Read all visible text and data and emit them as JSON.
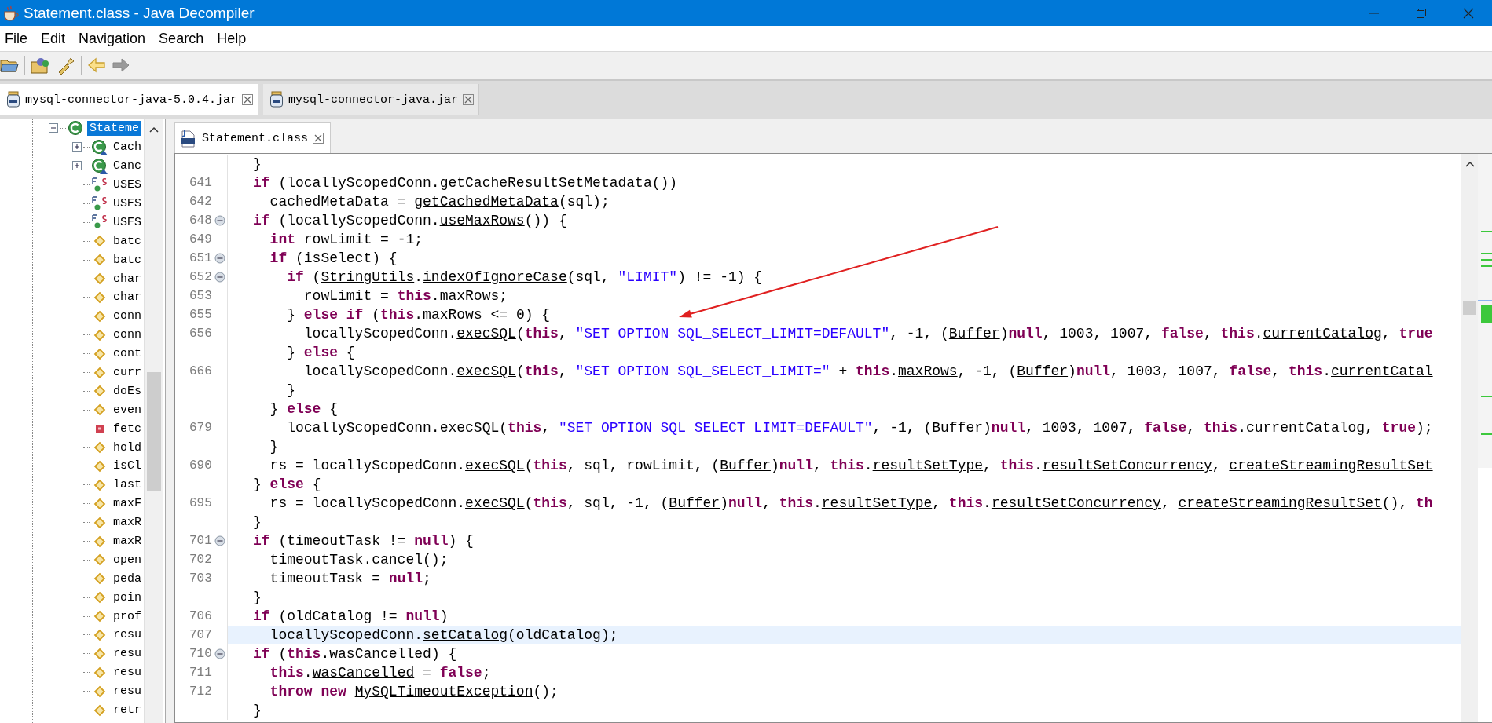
{
  "window": {
    "title": "Statement.class - Java Decompiler"
  },
  "menu": [
    "File",
    "Edit",
    "Navigation",
    "Search",
    "Help"
  ],
  "tabs": [
    {
      "label": "mysql-connector-java-5.0.4.jar",
      "selected": true
    },
    {
      "label": "mysql-connector-java.jar",
      "selected": false
    }
  ],
  "tree": {
    "items": [
      {
        "label": "Stateme",
        "kind": "class",
        "selected": true,
        "expanded": true,
        "children": [
          {
            "label": "Cach",
            "kind": "inner-class",
            "selected": false,
            "expanded": false
          },
          {
            "label": "Canc",
            "kind": "inner-class",
            "selected": false,
            "expanded": false
          },
          {
            "label": "USES",
            "kind": "static-field",
            "selected": false
          },
          {
            "label": "USES",
            "kind": "static-field",
            "selected": false
          },
          {
            "label": "USES",
            "kind": "static-field",
            "selected": false
          },
          {
            "label": "batc",
            "kind": "method",
            "selected": false
          },
          {
            "label": "batc",
            "kind": "method",
            "selected": false
          },
          {
            "label": "char",
            "kind": "method",
            "selected": false
          },
          {
            "label": "char",
            "kind": "method",
            "selected": false
          },
          {
            "label": "conn",
            "kind": "method",
            "selected": false
          },
          {
            "label": "conn",
            "kind": "method",
            "selected": false
          },
          {
            "label": "cont",
            "kind": "method",
            "selected": false
          },
          {
            "label": "curr",
            "kind": "method",
            "selected": false
          },
          {
            "label": "doEs",
            "kind": "method",
            "selected": false
          },
          {
            "label": "even",
            "kind": "method",
            "selected": false
          },
          {
            "label": "fetc",
            "kind": "private-method",
            "selected": false
          },
          {
            "label": "hold",
            "kind": "method",
            "selected": false
          },
          {
            "label": "isCl",
            "kind": "method",
            "selected": false
          },
          {
            "label": "last",
            "kind": "method",
            "selected": false
          },
          {
            "label": "maxF",
            "kind": "method",
            "selected": false
          },
          {
            "label": "maxR",
            "kind": "method",
            "selected": false
          },
          {
            "label": "maxR",
            "kind": "method",
            "selected": false
          },
          {
            "label": "open",
            "kind": "method",
            "selected": false
          },
          {
            "label": "peda",
            "kind": "method",
            "selected": false
          },
          {
            "label": "poin",
            "kind": "method",
            "selected": false
          },
          {
            "label": "prof",
            "kind": "method",
            "selected": false
          },
          {
            "label": "resu",
            "kind": "method",
            "selected": false
          },
          {
            "label": "resu",
            "kind": "method",
            "selected": false
          },
          {
            "label": "resu",
            "kind": "method",
            "selected": false
          },
          {
            "label": "resu",
            "kind": "method",
            "selected": false
          },
          {
            "label": "retr",
            "kind": "method",
            "selected": false
          }
        ]
      }
    ]
  },
  "editor": {
    "tabs": [
      {
        "label": "Statement.class",
        "selected": true
      }
    ],
    "lines": [
      {
        "foldable": false,
        "highlighted": false,
        "tokens": [
          {
            "kind": "txt",
            "text": "  }"
          }
        ]
      },
      {
        "number": "641",
        "foldable": false,
        "highlighted": false,
        "tokens": [
          {
            "kind": "kw",
            "text": "  if"
          },
          {
            "kind": "txt",
            "text": " (locallyScopedConn."
          },
          {
            "kind": "ref",
            "text": "getCacheResultSetMetadata"
          },
          {
            "kind": "txt",
            "text": "())"
          }
        ]
      },
      {
        "number": "642",
        "foldable": false,
        "highlighted": false,
        "tokens": [
          {
            "kind": "txt",
            "text": "    cachedMetaData = "
          },
          {
            "kind": "ref",
            "text": "getCachedMetaData"
          },
          {
            "kind": "txt",
            "text": "(sql);"
          }
        ]
      },
      {
        "number": "648",
        "foldable": true,
        "highlighted": false,
        "tokens": [
          {
            "kind": "kw",
            "text": "  if"
          },
          {
            "kind": "txt",
            "text": " (locallyScopedConn."
          },
          {
            "kind": "ref",
            "text": "useMaxRows"
          },
          {
            "kind": "txt",
            "text": "()) {"
          }
        ]
      },
      {
        "number": "649",
        "foldable": false,
        "highlighted": false,
        "tokens": [
          {
            "kind": "kw",
            "text": "    int"
          },
          {
            "kind": "txt",
            "text": " rowLimit = -1;"
          }
        ]
      },
      {
        "number": "651",
        "foldable": true,
        "highlighted": false,
        "tokens": [
          {
            "kind": "kw",
            "text": "    if"
          },
          {
            "kind": "txt",
            "text": " (isSelect) {"
          }
        ]
      },
      {
        "number": "652",
        "foldable": true,
        "highlighted": false,
        "tokens": [
          {
            "kind": "kw",
            "text": "      if"
          },
          {
            "kind": "txt",
            "text": " ("
          },
          {
            "kind": "ref",
            "text": "StringUtils"
          },
          {
            "kind": "txt",
            "text": "."
          },
          {
            "kind": "ref",
            "text": "indexOfIgnoreCase"
          },
          {
            "kind": "txt",
            "text": "(sql, "
          },
          {
            "kind": "str",
            "text": "\"LIMIT\""
          },
          {
            "kind": "txt",
            "text": ") != -1) {"
          }
        ]
      },
      {
        "number": "653",
        "foldable": false,
        "highlighted": false,
        "tokens": [
          {
            "kind": "txt",
            "text": "        rowLimit = "
          },
          {
            "kind": "kw",
            "text": "this"
          },
          {
            "kind": "txt",
            "text": "."
          },
          {
            "kind": "ref",
            "text": "maxRows"
          },
          {
            "kind": "txt",
            "text": ";"
          }
        ]
      },
      {
        "number": "655",
        "foldable": false,
        "highlighted": false,
        "tokens": [
          {
            "kind": "txt",
            "text": "      } "
          },
          {
            "kind": "kw",
            "text": "else if"
          },
          {
            "kind": "txt",
            "text": " ("
          },
          {
            "kind": "kw",
            "text": "this"
          },
          {
            "kind": "txt",
            "text": "."
          },
          {
            "kind": "ref",
            "text": "maxRows"
          },
          {
            "kind": "txt",
            "text": " <= 0) {"
          }
        ]
      },
      {
        "number": "656",
        "foldable": false,
        "highlighted": false,
        "tokens": [
          {
            "kind": "txt",
            "text": "        locallyScopedConn."
          },
          {
            "kind": "ref",
            "text": "execSQL"
          },
          {
            "kind": "txt",
            "text": "("
          },
          {
            "kind": "kw",
            "text": "this"
          },
          {
            "kind": "txt",
            "text": ", "
          },
          {
            "kind": "str",
            "text": "\"SET OPTION SQL_SELECT_LIMIT=DEFAULT\""
          },
          {
            "kind": "txt",
            "text": ", -1, ("
          },
          {
            "kind": "ref",
            "text": "Buffer"
          },
          {
            "kind": "txt",
            "text": ")"
          },
          {
            "kind": "kw",
            "text": "null"
          },
          {
            "kind": "txt",
            "text": ", 1003, 1007, "
          },
          {
            "kind": "kw",
            "text": "false"
          },
          {
            "kind": "txt",
            "text": ", "
          },
          {
            "kind": "kw",
            "text": "this"
          },
          {
            "kind": "txt",
            "text": "."
          },
          {
            "kind": "ref",
            "text": "currentCatalog"
          },
          {
            "kind": "txt",
            "text": ", "
          },
          {
            "kind": "kw",
            "text": "true"
          }
        ]
      },
      {
        "foldable": false,
        "highlighted": false,
        "tokens": [
          {
            "kind": "txt",
            "text": "      } "
          },
          {
            "kind": "kw",
            "text": "else"
          },
          {
            "kind": "txt",
            "text": " {"
          }
        ]
      },
      {
        "number": "666",
        "foldable": false,
        "highlighted": false,
        "tokens": [
          {
            "kind": "txt",
            "text": "        locallyScopedConn."
          },
          {
            "kind": "ref",
            "text": "execSQL"
          },
          {
            "kind": "txt",
            "text": "("
          },
          {
            "kind": "kw",
            "text": "this"
          },
          {
            "kind": "txt",
            "text": ", "
          },
          {
            "kind": "str",
            "text": "\"SET OPTION SQL_SELECT_LIMIT=\""
          },
          {
            "kind": "txt",
            "text": " + "
          },
          {
            "kind": "kw",
            "text": "this"
          },
          {
            "kind": "txt",
            "text": "."
          },
          {
            "kind": "ref",
            "text": "maxRows"
          },
          {
            "kind": "txt",
            "text": ", -1, ("
          },
          {
            "kind": "ref",
            "text": "Buffer"
          },
          {
            "kind": "txt",
            "text": ")"
          },
          {
            "kind": "kw",
            "text": "null"
          },
          {
            "kind": "txt",
            "text": ", 1003, 1007, "
          },
          {
            "kind": "kw",
            "text": "false"
          },
          {
            "kind": "txt",
            "text": ", "
          },
          {
            "kind": "kw",
            "text": "this"
          },
          {
            "kind": "txt",
            "text": "."
          },
          {
            "kind": "ref",
            "text": "currentCatal"
          }
        ]
      },
      {
        "foldable": false,
        "highlighted": false,
        "tokens": [
          {
            "kind": "txt",
            "text": "      }"
          }
        ]
      },
      {
        "foldable": false,
        "highlighted": false,
        "tokens": [
          {
            "kind": "txt",
            "text": "    } "
          },
          {
            "kind": "kw",
            "text": "else"
          },
          {
            "kind": "txt",
            "text": " {"
          }
        ]
      },
      {
        "number": "679",
        "foldable": false,
        "highlighted": false,
        "tokens": [
          {
            "kind": "txt",
            "text": "      locallyScopedConn."
          },
          {
            "kind": "ref",
            "text": "execSQL"
          },
          {
            "kind": "txt",
            "text": "("
          },
          {
            "kind": "kw",
            "text": "this"
          },
          {
            "kind": "txt",
            "text": ", "
          },
          {
            "kind": "str",
            "text": "\"SET OPTION SQL_SELECT_LIMIT=DEFAULT\""
          },
          {
            "kind": "txt",
            "text": ", -1, ("
          },
          {
            "kind": "ref",
            "text": "Buffer"
          },
          {
            "kind": "txt",
            "text": ")"
          },
          {
            "kind": "kw",
            "text": "null"
          },
          {
            "kind": "txt",
            "text": ", 1003, 1007, "
          },
          {
            "kind": "kw",
            "text": "false"
          },
          {
            "kind": "txt",
            "text": ", "
          },
          {
            "kind": "kw",
            "text": "this"
          },
          {
            "kind": "txt",
            "text": "."
          },
          {
            "kind": "ref",
            "text": "currentCatalog"
          },
          {
            "kind": "txt",
            "text": ", "
          },
          {
            "kind": "kw",
            "text": "true"
          },
          {
            "kind": "txt",
            "text": ");"
          }
        ]
      },
      {
        "foldable": false,
        "highlighted": false,
        "tokens": [
          {
            "kind": "txt",
            "text": "    }"
          }
        ]
      },
      {
        "number": "690",
        "foldable": false,
        "highlighted": false,
        "tokens": [
          {
            "kind": "txt",
            "text": "    rs = locallyScopedConn."
          },
          {
            "kind": "ref",
            "text": "execSQL"
          },
          {
            "kind": "txt",
            "text": "("
          },
          {
            "kind": "kw",
            "text": "this"
          },
          {
            "kind": "txt",
            "text": ", sql, rowLimit, ("
          },
          {
            "kind": "ref",
            "text": "Buffer"
          },
          {
            "kind": "txt",
            "text": ")"
          },
          {
            "kind": "kw",
            "text": "null"
          },
          {
            "kind": "txt",
            "text": ", "
          },
          {
            "kind": "kw",
            "text": "this"
          },
          {
            "kind": "txt",
            "text": "."
          },
          {
            "kind": "ref",
            "text": "resultSetType"
          },
          {
            "kind": "txt",
            "text": ", "
          },
          {
            "kind": "kw",
            "text": "this"
          },
          {
            "kind": "txt",
            "text": "."
          },
          {
            "kind": "ref",
            "text": "resultSetConcurrency"
          },
          {
            "kind": "txt",
            "text": ", "
          },
          {
            "kind": "ref",
            "text": "createStreamingResultSet"
          }
        ]
      },
      {
        "foldable": false,
        "highlighted": false,
        "tokens": [
          {
            "kind": "txt",
            "text": "  } "
          },
          {
            "kind": "kw",
            "text": "else"
          },
          {
            "kind": "txt",
            "text": " {"
          }
        ]
      },
      {
        "number": "695",
        "foldable": false,
        "highlighted": false,
        "tokens": [
          {
            "kind": "txt",
            "text": "    rs = locallyScopedConn."
          },
          {
            "kind": "ref",
            "text": "execSQL"
          },
          {
            "kind": "txt",
            "text": "("
          },
          {
            "kind": "kw",
            "text": "this"
          },
          {
            "kind": "txt",
            "text": ", sql, -1, ("
          },
          {
            "kind": "ref",
            "text": "Buffer"
          },
          {
            "kind": "txt",
            "text": ")"
          },
          {
            "kind": "kw",
            "text": "null"
          },
          {
            "kind": "txt",
            "text": ", "
          },
          {
            "kind": "kw",
            "text": "this"
          },
          {
            "kind": "txt",
            "text": "."
          },
          {
            "kind": "ref",
            "text": "resultSetType"
          },
          {
            "kind": "txt",
            "text": ", "
          },
          {
            "kind": "kw",
            "text": "this"
          },
          {
            "kind": "txt",
            "text": "."
          },
          {
            "kind": "ref",
            "text": "resultSetConcurrency"
          },
          {
            "kind": "txt",
            "text": ", "
          },
          {
            "kind": "ref",
            "text": "createStreamingResultSet"
          },
          {
            "kind": "txt",
            "text": "(), "
          },
          {
            "kind": "kw",
            "text": "th"
          }
        ]
      },
      {
        "foldable": false,
        "highlighted": false,
        "tokens": [
          {
            "kind": "txt",
            "text": "  }"
          }
        ]
      },
      {
        "number": "701",
        "foldable": true,
        "highlighted": false,
        "tokens": [
          {
            "kind": "kw",
            "text": "  if"
          },
          {
            "kind": "txt",
            "text": " (timeoutTask != "
          },
          {
            "kind": "kw",
            "text": "null"
          },
          {
            "kind": "txt",
            "text": ") {"
          }
        ]
      },
      {
        "number": "702",
        "foldable": false,
        "highlighted": false,
        "tokens": [
          {
            "kind": "txt",
            "text": "    timeoutTask.cancel();"
          }
        ]
      },
      {
        "number": "703",
        "foldable": false,
        "highlighted": false,
        "tokens": [
          {
            "kind": "txt",
            "text": "    timeoutTask = "
          },
          {
            "kind": "kw",
            "text": "null"
          },
          {
            "kind": "txt",
            "text": ";"
          }
        ]
      },
      {
        "foldable": false,
        "highlighted": false,
        "tokens": [
          {
            "kind": "txt",
            "text": "  }"
          }
        ]
      },
      {
        "number": "706",
        "foldable": false,
        "highlighted": false,
        "tokens": [
          {
            "kind": "kw",
            "text": "  if"
          },
          {
            "kind": "txt",
            "text": " (oldCatalog != "
          },
          {
            "kind": "kw",
            "text": "null"
          },
          {
            "kind": "txt",
            "text": ")"
          }
        ]
      },
      {
        "number": "707",
        "foldable": false,
        "highlighted": true,
        "tokens": [
          {
            "kind": "txt",
            "text": "    locallyScopedConn."
          },
          {
            "kind": "ref",
            "text": "setCatalog"
          },
          {
            "kind": "txt",
            "text": "(oldCatalog);"
          }
        ]
      },
      {
        "number": "710",
        "foldable": true,
        "highlighted": false,
        "tokens": [
          {
            "kind": "kw",
            "text": "  if"
          },
          {
            "kind": "txt",
            "text": " ("
          },
          {
            "kind": "kw",
            "text": "this"
          },
          {
            "kind": "txt",
            "text": "."
          },
          {
            "kind": "ref",
            "text": "wasCancelled"
          },
          {
            "kind": "txt",
            "text": ") {"
          }
        ]
      },
      {
        "number": "711",
        "foldable": false,
        "highlighted": false,
        "tokens": [
          {
            "kind": "kw",
            "text": "    this"
          },
          {
            "kind": "txt",
            "text": "."
          },
          {
            "kind": "ref",
            "text": "wasCancelled"
          },
          {
            "kind": "txt",
            "text": " = "
          },
          {
            "kind": "kw",
            "text": "false"
          },
          {
            "kind": "txt",
            "text": ";"
          }
        ]
      },
      {
        "number": "712",
        "foldable": false,
        "highlighted": false,
        "tokens": [
          {
            "kind": "kw",
            "text": "    throw new "
          },
          {
            "kind": "ref",
            "text": "MySQLTimeoutException"
          },
          {
            "kind": "txt",
            "text": "();"
          }
        ]
      },
      {
        "foldable": false,
        "highlighted": false,
        "tokens": [
          {
            "kind": "txt",
            "text": "  }"
          }
        ]
      }
    ]
  }
}
